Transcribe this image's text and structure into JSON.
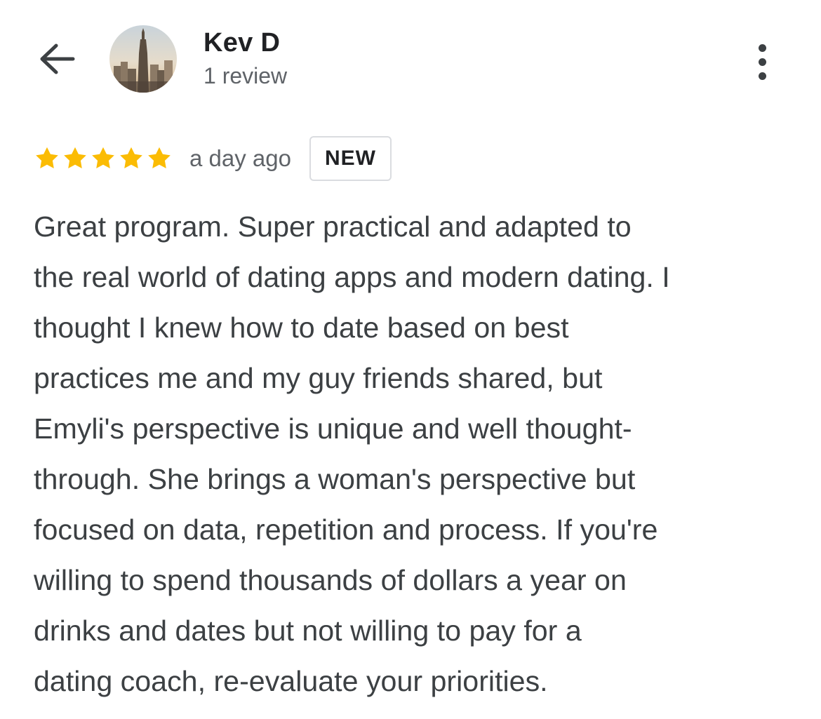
{
  "reviewer": {
    "name": "Kev D",
    "review_count": "1 review",
    "avatar_icon": "city-skyline-avatar"
  },
  "header": {
    "back_icon": "arrow-left-icon",
    "more_icon": "more-vertical-icon"
  },
  "review": {
    "rating": 5,
    "rating_max": 5,
    "star_color": "#fbbc04",
    "time": "a day ago",
    "badge": "NEW",
    "text_lines": [
      "Great program. Super practical and adapted to",
      "the real world of dating apps and modern dating. I",
      "thought I knew how to date based on best",
      "practices me and my guy friends shared, but",
      "Emyli's perspective is unique and well thought-",
      "through. She brings a woman's perspective but",
      "focused on data, repetition and process. If you're",
      "willing to spend thousands of dollars a year on",
      "drinks and dates but not willing to pay for a",
      "dating coach, re-evaluate your priorities."
    ]
  }
}
